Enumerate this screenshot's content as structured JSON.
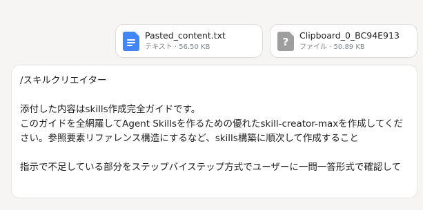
{
  "attachments": [
    {
      "name": "Pasted_content.txt",
      "meta": "テキスト · 56.50 KB",
      "icon": "text-document-icon",
      "icon_color": "#4285f4"
    },
    {
      "name": "Clipboard_0_BC94E913",
      "meta": "ファイル · 50.89 KB",
      "icon": "unknown-file-icon",
      "icon_color": "#9e9e9e"
    }
  ],
  "message": {
    "command": "/スキルクリエイター",
    "para1_line1": "添付した内容はskills作成完全ガイドです。",
    "para1_line2": "このガイドを全網羅してAgent Skillsを作るための優れたskill-creator-maxを作成してください。参照要素リファレンス構造にするなど、skills構築に順次して作成すること",
    "para2": "指示で不足している部分をステップバイステップ方式でユーザーに一問一答形式で確認して"
  }
}
